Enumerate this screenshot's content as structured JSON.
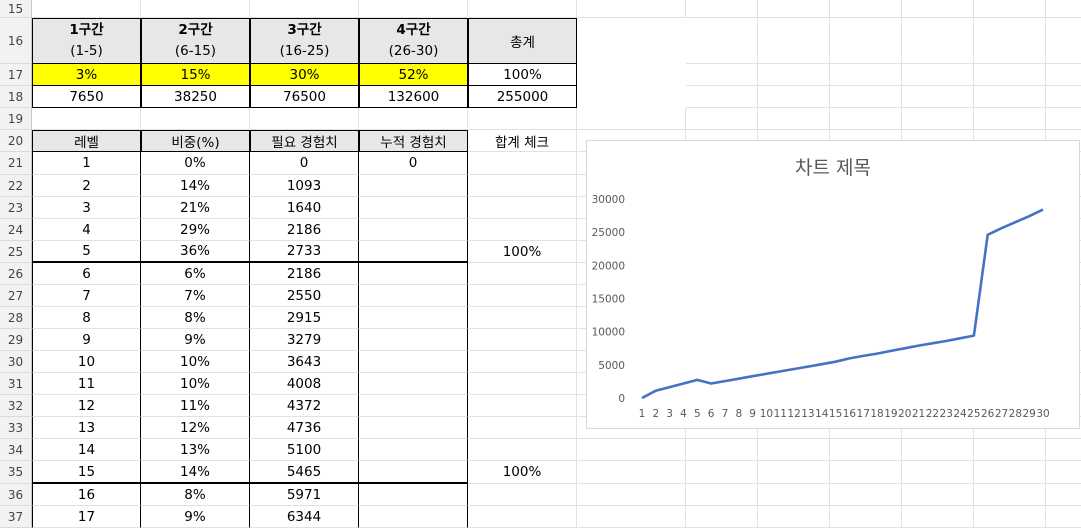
{
  "rows": [
    15,
    16,
    17,
    18,
    19,
    20,
    21,
    22,
    23,
    24,
    25,
    26,
    27,
    28,
    29,
    30,
    31,
    32,
    33,
    34,
    35,
    36,
    37
  ],
  "summary": {
    "headers": [
      {
        "title": "1구간",
        "range": "(1-5)"
      },
      {
        "title": "2구간",
        "range": "(6-15)"
      },
      {
        "title": "3구간",
        "range": "(16-25)"
      },
      {
        "title": "4구간",
        "range": "(26-30)"
      }
    ],
    "total_header": "총계",
    "percents": [
      "3%",
      "15%",
      "30%",
      "52%"
    ],
    "total_percent": "100%",
    "amounts": [
      "7650",
      "38250",
      "76500",
      "132600"
    ],
    "total_amount": "255000"
  },
  "table": {
    "headers": [
      "레벨",
      "비중(%)",
      "필요 경험치",
      "누적 경험치"
    ],
    "sum_check_header": "합계 체크",
    "rows": [
      {
        "level": "1",
        "pct": "0%",
        "req": "0",
        "cum": "0",
        "check": ""
      },
      {
        "level": "2",
        "pct": "14%",
        "req": "1093",
        "cum": "",
        "check": ""
      },
      {
        "level": "3",
        "pct": "21%",
        "req": "1640",
        "cum": "",
        "check": ""
      },
      {
        "level": "4",
        "pct": "29%",
        "req": "2186",
        "cum": "",
        "check": ""
      },
      {
        "level": "5",
        "pct": "36%",
        "req": "2733",
        "cum": "",
        "check": "100%"
      },
      {
        "level": "6",
        "pct": "6%",
        "req": "2186",
        "cum": "",
        "check": ""
      },
      {
        "level": "7",
        "pct": "7%",
        "req": "2550",
        "cum": "",
        "check": ""
      },
      {
        "level": "8",
        "pct": "8%",
        "req": "2915",
        "cum": "",
        "check": ""
      },
      {
        "level": "9",
        "pct": "9%",
        "req": "3279",
        "cum": "",
        "check": ""
      },
      {
        "level": "10",
        "pct": "10%",
        "req": "3643",
        "cum": "",
        "check": ""
      },
      {
        "level": "11",
        "pct": "10%",
        "req": "4008",
        "cum": "",
        "check": ""
      },
      {
        "level": "12",
        "pct": "11%",
        "req": "4372",
        "cum": "",
        "check": ""
      },
      {
        "level": "13",
        "pct": "12%",
        "req": "4736",
        "cum": "",
        "check": ""
      },
      {
        "level": "14",
        "pct": "13%",
        "req": "5100",
        "cum": "",
        "check": ""
      },
      {
        "level": "15",
        "pct": "14%",
        "req": "5465",
        "cum": "",
        "check": "100%"
      },
      {
        "level": "16",
        "pct": "8%",
        "req": "5971",
        "cum": "",
        "check": ""
      },
      {
        "level": "17",
        "pct": "9%",
        "req": "6344",
        "cum": "",
        "check": ""
      }
    ]
  },
  "chart_data": {
    "type": "line",
    "title": "차트 제목",
    "x": [
      1,
      2,
      3,
      4,
      5,
      6,
      7,
      8,
      9,
      10,
      11,
      12,
      13,
      14,
      15,
      16,
      17,
      18,
      19,
      20,
      21,
      22,
      23,
      24,
      25,
      26,
      27,
      28,
      29,
      30
    ],
    "series": [
      {
        "values": [
          0,
          1093,
          1640,
          2186,
          2733,
          2186,
          2550,
          2915,
          3279,
          3643,
          4008,
          4372,
          4736,
          5100,
          5465,
          5971,
          6344,
          6700,
          7100,
          7500,
          7900,
          8250,
          8600,
          9000,
          9400,
          24600,
          25600,
          26500,
          27400,
          28400
        ]
      }
    ],
    "ylim": [
      0,
      30000
    ],
    "yticks": [
      0,
      5000,
      10000,
      15000,
      20000,
      25000,
      30000
    ],
    "xlabel": "",
    "ylabel": "",
    "grid": false,
    "line_color": "#4472c4"
  }
}
